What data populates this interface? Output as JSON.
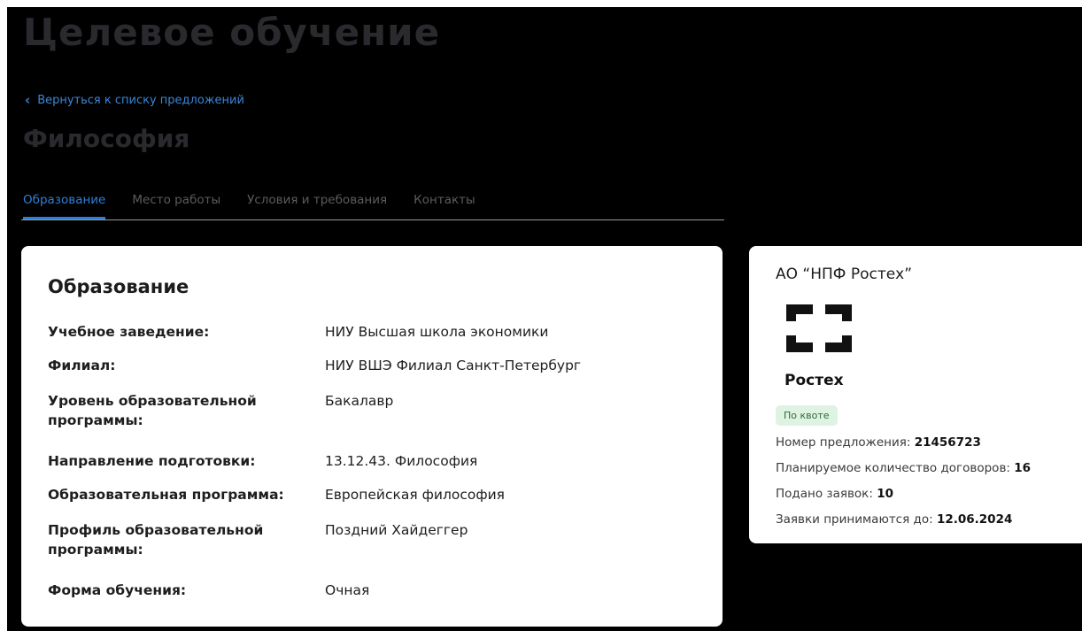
{
  "page_title": "Целевое обучение",
  "back_link": "Вернуться к списку предложений",
  "sub_title": "Философия",
  "tabs": [
    {
      "label": "Образование"
    },
    {
      "label": "Место работы"
    },
    {
      "label": "Условия и требования"
    },
    {
      "label": "Контакты"
    }
  ],
  "education": {
    "heading": "Образование",
    "rows": [
      {
        "label": "Учебное заведение:",
        "value": "НИУ Высшая школа экономики"
      },
      {
        "label": "Филиал:",
        "value": "НИУ ВШЭ Филиал Санкт-Петербург"
      },
      {
        "label": "Уровень образовательной программы:",
        "value": "Бакалавр"
      },
      {
        "label": "Направление подготовки:",
        "value": "13.12.43. Философия"
      },
      {
        "label": "Образовательная программа:",
        "value": "Европейская философия"
      },
      {
        "label": "Профиль образовательной программы:",
        "value": "Поздний Хайдеггер"
      },
      {
        "label": "Форма обучения:",
        "value": "Очная"
      }
    ]
  },
  "company": {
    "name": "АО “НПФ Ростех”",
    "logo_text": "Ростех",
    "logo_icon": "rostec-logo",
    "badge": "По квоте",
    "offer_label": "Номер предложения:",
    "offer_value": "21456723",
    "planned_label": "Планируемое количество договоров:",
    "planned_value": "16",
    "submitted_label": "Подано заявок:",
    "submitted_value": "10",
    "deadline_label": "Заявки принимаются до:",
    "deadline_value": "12.06.2024"
  },
  "colors": {
    "accent": "#2f7fd6",
    "background": "#000000",
    "badge_bg": "#dff3e2"
  }
}
